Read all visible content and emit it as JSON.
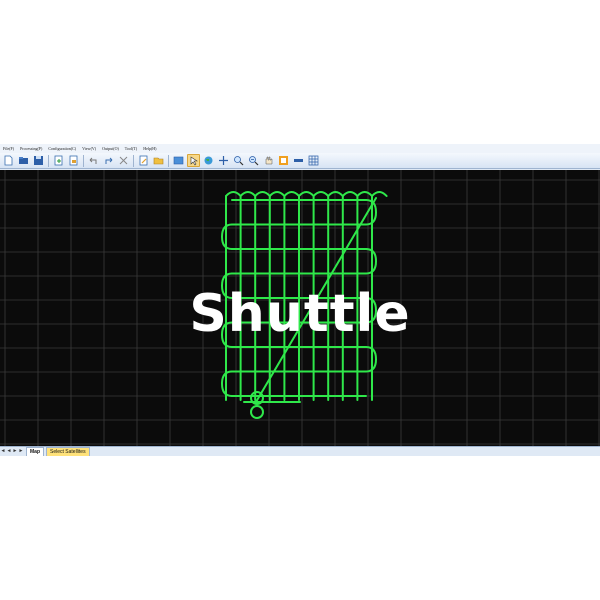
{
  "menu": [
    "File(F)",
    "Processing(P)",
    "Configuration(C)",
    "View(V)",
    "Output(O)",
    "Tool(T)",
    "Help(H)"
  ],
  "toolbar": {
    "buttons": [
      "new-file-icon",
      "open-folder-icon",
      "save-icon",
      "export-icon",
      "import-icon",
      "undo-icon",
      "redo-icon",
      "cut-icon",
      "edit-icon",
      "folder-icon",
      "map-view-icon",
      "select-cursor-icon",
      "globe-icon",
      "pan-arrows-icon",
      "zoom-in-icon",
      "zoom-out-icon",
      "hand-icon",
      "frame-icon",
      "measure-icon",
      "grid-icon"
    ],
    "active": "select-cursor-icon"
  },
  "overlay_title": "Shuttle",
  "tabs": {
    "nav_arrows": [
      "◄",
      "◄",
      "►",
      "►"
    ],
    "items": [
      "Map",
      "Select Satellites"
    ]
  },
  "colors": {
    "map_bg": "#0b0b0b",
    "grid": "#3a3a3a",
    "track": "#2fe84a",
    "overlay": "#ffffff"
  }
}
